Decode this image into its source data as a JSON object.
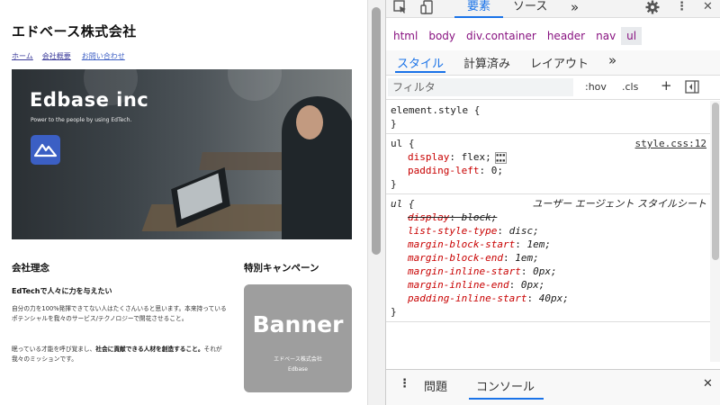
{
  "site": {
    "title": "エドベース株式会社",
    "nav": [
      "ホーム",
      "会社概要",
      "お問い合わせ"
    ],
    "hero": {
      "title": "Edbase inc",
      "subtitle": "Power to the people by using EdTech."
    },
    "philosophy": {
      "heading": "会社理念",
      "subheading": "EdTechで人々に力を与えたい",
      "paragraph1": "自分の力を100%発揮できてない人はたくさんいると思います。本来持っているポテンシャルを我々のサービス/テクノロジーで開花させること。",
      "paragraph2_pre": "眠っている才能を呼び覚まし、",
      "paragraph2_bold": "社会に貢献できる人材を創造すること。",
      "paragraph2_post": "それが我々のミッションです。"
    },
    "campaign": {
      "heading": "特別キャンペーン",
      "banner_big": "Banner",
      "banner_line1": "エドベース株式会社",
      "banner_line2": "Edbase"
    }
  },
  "devtools": {
    "toolbar": {
      "tab_elements": "要素",
      "tab_sources": "ソース",
      "more": "»",
      "settings_icon": "gear-icon",
      "menu_icon": "kebab-icon",
      "close": "✕"
    },
    "breadcrumbs": [
      "html",
      "body",
      "div.container",
      "header",
      "nav",
      "ul"
    ],
    "subtabs": [
      "スタイル",
      "計算済み",
      "レイアウト",
      "»"
    ],
    "filter": {
      "placeholder": "フィルタ",
      "hov": ":hov",
      "cls": ".cls",
      "plus": "+"
    },
    "rules": {
      "element_style": {
        "selector": "element.style {",
        "close": "}"
      },
      "author": {
        "selector": "ul {",
        "source": "style.css:12",
        "props": [
          {
            "name": "display",
            "value": "flex;"
          },
          {
            "name": "padding-left",
            "value": "0;"
          }
        ],
        "close": "}"
      },
      "ua": {
        "selector": "ul {",
        "source": "ユーザー エージェント スタイルシート",
        "props": [
          {
            "name": "display",
            "value": "block;"
          },
          {
            "name": "list-style-type",
            "value": "disc;"
          },
          {
            "name": "margin-block-start",
            "value": "1em;"
          },
          {
            "name": "margin-block-end",
            "value": "1em;"
          },
          {
            "name": "margin-inline-start",
            "value": "0px;"
          },
          {
            "name": "margin-inline-end",
            "value": "0px;"
          },
          {
            "name": "padding-inline-start",
            "value": "40px;"
          }
        ],
        "close": "}"
      }
    },
    "drawer": {
      "tab_issues": "問題",
      "tab_console": "コンソール",
      "close": "✕"
    }
  }
}
